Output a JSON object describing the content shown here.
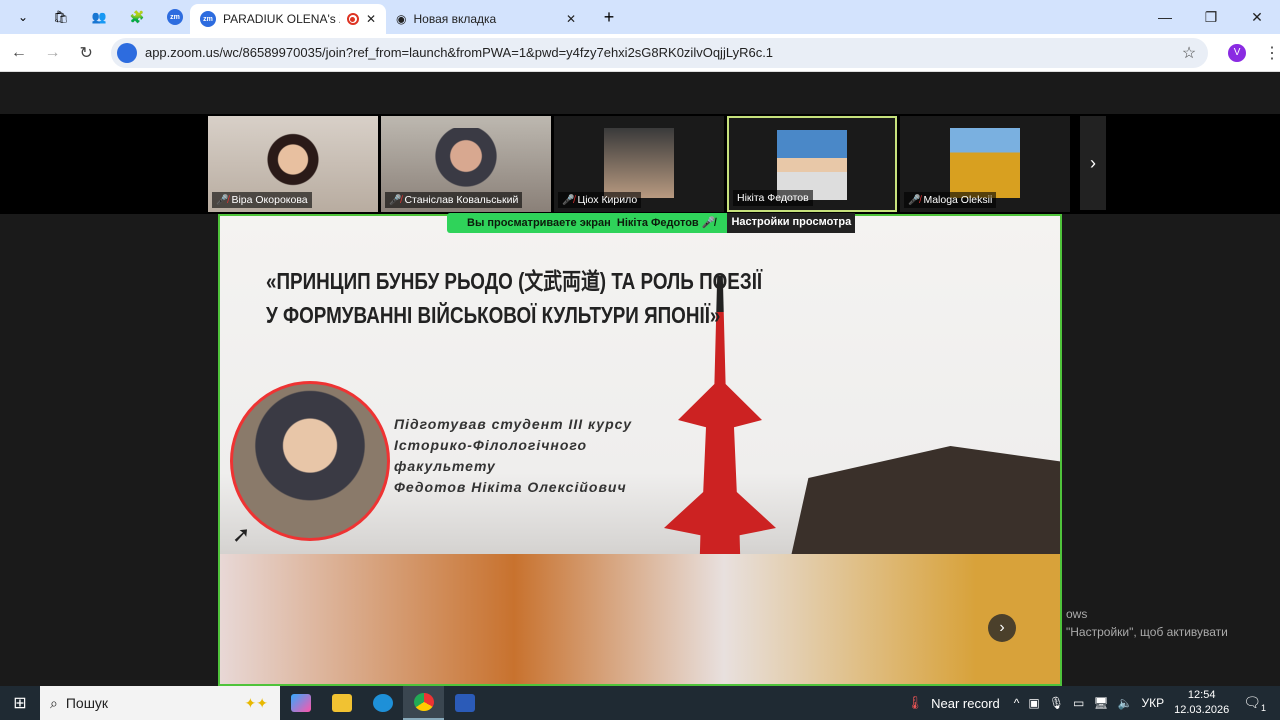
{
  "browser": {
    "tabs": [
      {
        "title": "PARADIUK OLENA's Zoom Meeting",
        "active": true,
        "recording": true
      },
      {
        "title": "Новая вкладка",
        "active": false
      }
    ],
    "url": "app.zoom.us/wc/86589970035/join?ref_from=launch&fromPWA=1&pwd=y4fzy7ehxi2sG8RK0zilvOqjjLyR6c.1",
    "profile_initial": "V"
  },
  "participants": [
    {
      "name": "Віра Окорокова",
      "muted": true
    },
    {
      "name": "Станіслав Ковальський",
      "muted": true
    },
    {
      "name": "Ціох Кирило",
      "muted": true
    },
    {
      "name": "Нікіта Федотов",
      "muted": false,
      "active": true
    },
    {
      "name": "Maloga Oleksii",
      "muted": true
    }
  ],
  "share_banner": {
    "text": "Вы просматриваете экран",
    "presenter": "Нікіта Федотов",
    "settings": "Настройки просмотра"
  },
  "slide": {
    "title_lines": [
      "«ПРИНЦИП БУНБУ РЬОДО (文武両道) ТА РОЛЬ ПОЕЗІЇ",
      "У ФОРМУВАННІ ВІЙСЬКОВОЇ КУЛЬТУРИ ЯПОНІЇ»"
    ],
    "author_lines": [
      "Підготував студент III курсу",
      "Історико-Філологічного",
      "факультету",
      "Федотов Нікіта Олексійович"
    ]
  },
  "watermark": {
    "line1": "ows",
    "line2": "\"Настройки\", щоб активувати"
  },
  "taskbar": {
    "search": "Пошук",
    "weather": "Near record",
    "language": "УКР",
    "time": "12:54",
    "date": "12.03.2026",
    "notifications": "1"
  },
  "colors": {
    "share_border": "#4fc33b",
    "banner": "#2fd35a",
    "active_tile": "#c6e17c"
  }
}
